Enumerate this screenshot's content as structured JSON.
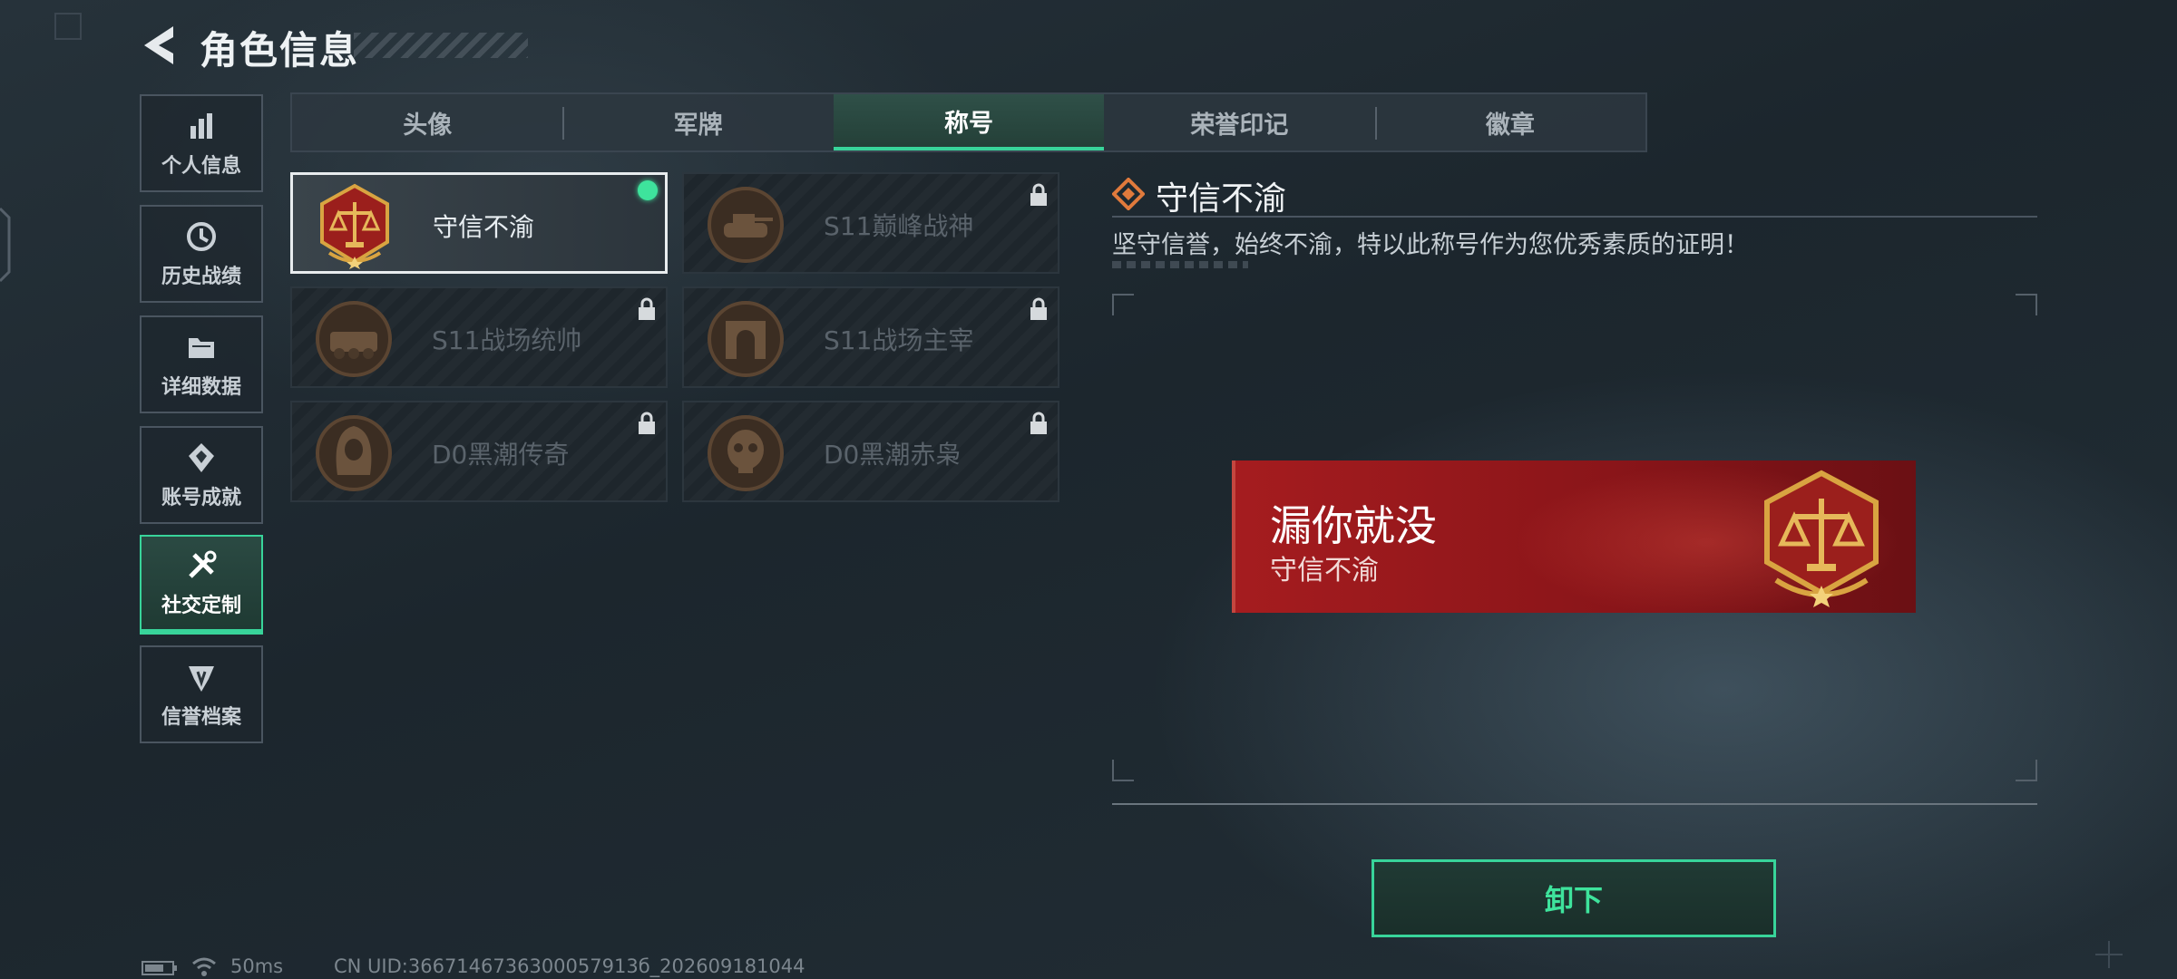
{
  "header": {
    "title": "角色信息"
  },
  "nav": [
    {
      "label": "个人信息",
      "icon": "bar-chart-icon",
      "active": false
    },
    {
      "label": "历史战绩",
      "icon": "history-clock-icon",
      "active": false
    },
    {
      "label": "详细数据",
      "icon": "folder-icon",
      "active": false
    },
    {
      "label": "账号成就",
      "icon": "achievement-icon",
      "active": false
    },
    {
      "label": "社交定制",
      "icon": "tools-icon",
      "active": true
    },
    {
      "label": "信誉档案",
      "icon": "reputation-icon",
      "active": false
    }
  ],
  "tabs": [
    {
      "label": "头像",
      "active": false
    },
    {
      "label": "军牌",
      "active": false
    },
    {
      "label": "称号",
      "active": true
    },
    {
      "label": "荣誉印记",
      "active": false
    },
    {
      "label": "徽章",
      "active": false
    }
  ],
  "titles": [
    {
      "label": "守信不渝",
      "medal": "justice-scale-icon",
      "selected": true,
      "locked": false,
      "equipped": true
    },
    {
      "label": "S11巅峰战神",
      "medal": "tank-medal-icon",
      "selected": false,
      "locked": true,
      "equipped": false
    },
    {
      "label": "S11战场统帅",
      "medal": "armored-vehicle-medal-icon",
      "selected": false,
      "locked": true,
      "equipped": false
    },
    {
      "label": "S11战场主宰",
      "medal": "arch-medal-icon",
      "selected": false,
      "locked": true,
      "equipped": false
    },
    {
      "label": "D0黑潮传奇",
      "medal": "hooded-figure-medal-icon",
      "selected": false,
      "locked": true,
      "equipped": false
    },
    {
      "label": "D0黑潮赤枭",
      "medal": "skull-medal-icon",
      "selected": false,
      "locked": true,
      "equipped": false
    }
  ],
  "detail": {
    "title": "守信不渝",
    "description": "坚守信誉，始终不渝，特以此称号作为您优秀素质的证明！"
  },
  "nameplate": {
    "player_name": "漏你就没",
    "title": "守信不渝"
  },
  "actions": {
    "unequip_label": "卸下"
  },
  "status": {
    "ping": "50ms",
    "uid": "CN UID:3667146736300057913б_202609181044"
  },
  "colors": {
    "accent": "#38d49a",
    "nameplate_red": "#a51c1f",
    "medal_gold": "#d9a441"
  }
}
